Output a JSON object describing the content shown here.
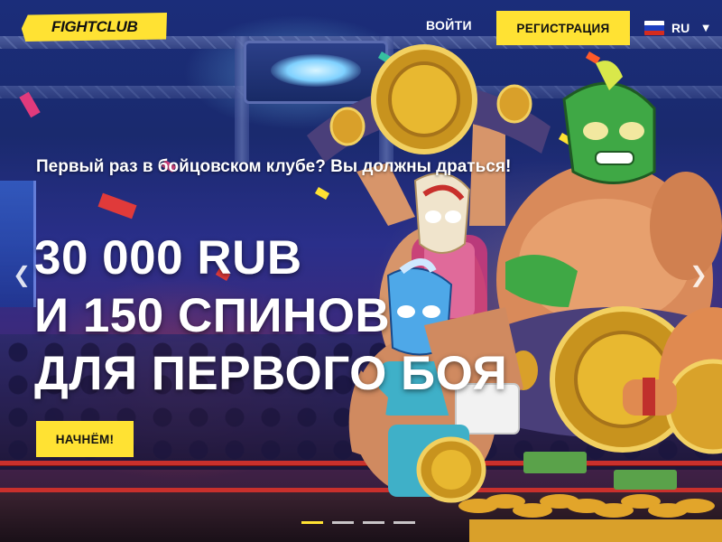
{
  "header": {
    "logo_text": "FIGHTCLUB",
    "login_label": "ВОЙТИ",
    "register_label": "РЕГИСТРАЦИЯ",
    "language": {
      "code": "RU",
      "flag_colors": [
        "#ffffff",
        "#1c3fc0",
        "#d52b1e"
      ]
    }
  },
  "hero": {
    "tagline": "Первый раз в бойцовском клубе? Вы должны драться!",
    "headline_lines": [
      "30 000 RUB",
      "И 150 СПИНОВ",
      "ДЛЯ ПЕРВОГО БОЯ"
    ],
    "cta_label": "НАЧНЁМ!",
    "prev_arrow": "chevron-left-icon",
    "next_arrow": "chevron-right-icon"
  },
  "carousel": {
    "slide_count": 4,
    "active_slide": 1
  },
  "colors": {
    "accent": "#ffe233",
    "text": "#ffffff",
    "dark_text": "#111111"
  }
}
